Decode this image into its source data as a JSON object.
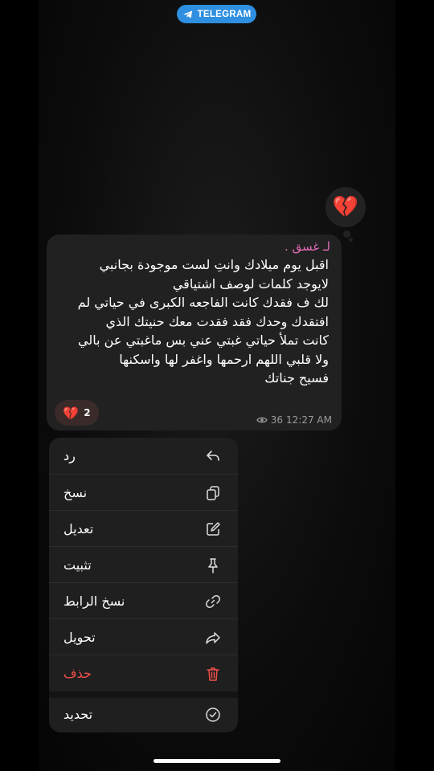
{
  "badge": {
    "label": "TELEGRAM"
  },
  "floating_reaction": {
    "emoji": "💔"
  },
  "message": {
    "sender": "لـ غسق .",
    "lines": [
      "اقبل يوم ميلادك وانتِ لست موجودة بجانبي",
      "لايوجد كلمات لوصف اشتياقي",
      "لك ف فقدك كانت الفاجعه الكبرى في حياتي لم",
      "افتقدك وحدك فقد فقدت معك حنيتك الذي",
      "كانت تملأ حياتي غبتي عني بس ماغبتي عن بالي",
      "ولا قلبي اللهم ارحمها واغفر لها واسكنها",
      "فسيح جناتك"
    ],
    "reaction": {
      "emoji": "💔",
      "count": "2"
    },
    "views": "36",
    "time": "12:27 AM"
  },
  "menu": {
    "items": [
      {
        "label": "رد",
        "icon": "reply-icon"
      },
      {
        "label": "نسخ",
        "icon": "copy-icon"
      },
      {
        "label": "تعديل",
        "icon": "edit-icon"
      },
      {
        "label": "تثبيت",
        "icon": "pin-icon"
      },
      {
        "label": "نسخ الرابط",
        "icon": "link-icon"
      },
      {
        "label": "تحويل",
        "icon": "forward-icon"
      },
      {
        "label": "حذف",
        "icon": "trash-icon"
      },
      {
        "label": "تحديد",
        "icon": "select-icon"
      }
    ]
  },
  "colors": {
    "badge": "#2f8fe0",
    "sender": "#e36bb9",
    "danger": "#f0504a",
    "bubble": "#212121",
    "menu": "#1f1f1f"
  }
}
